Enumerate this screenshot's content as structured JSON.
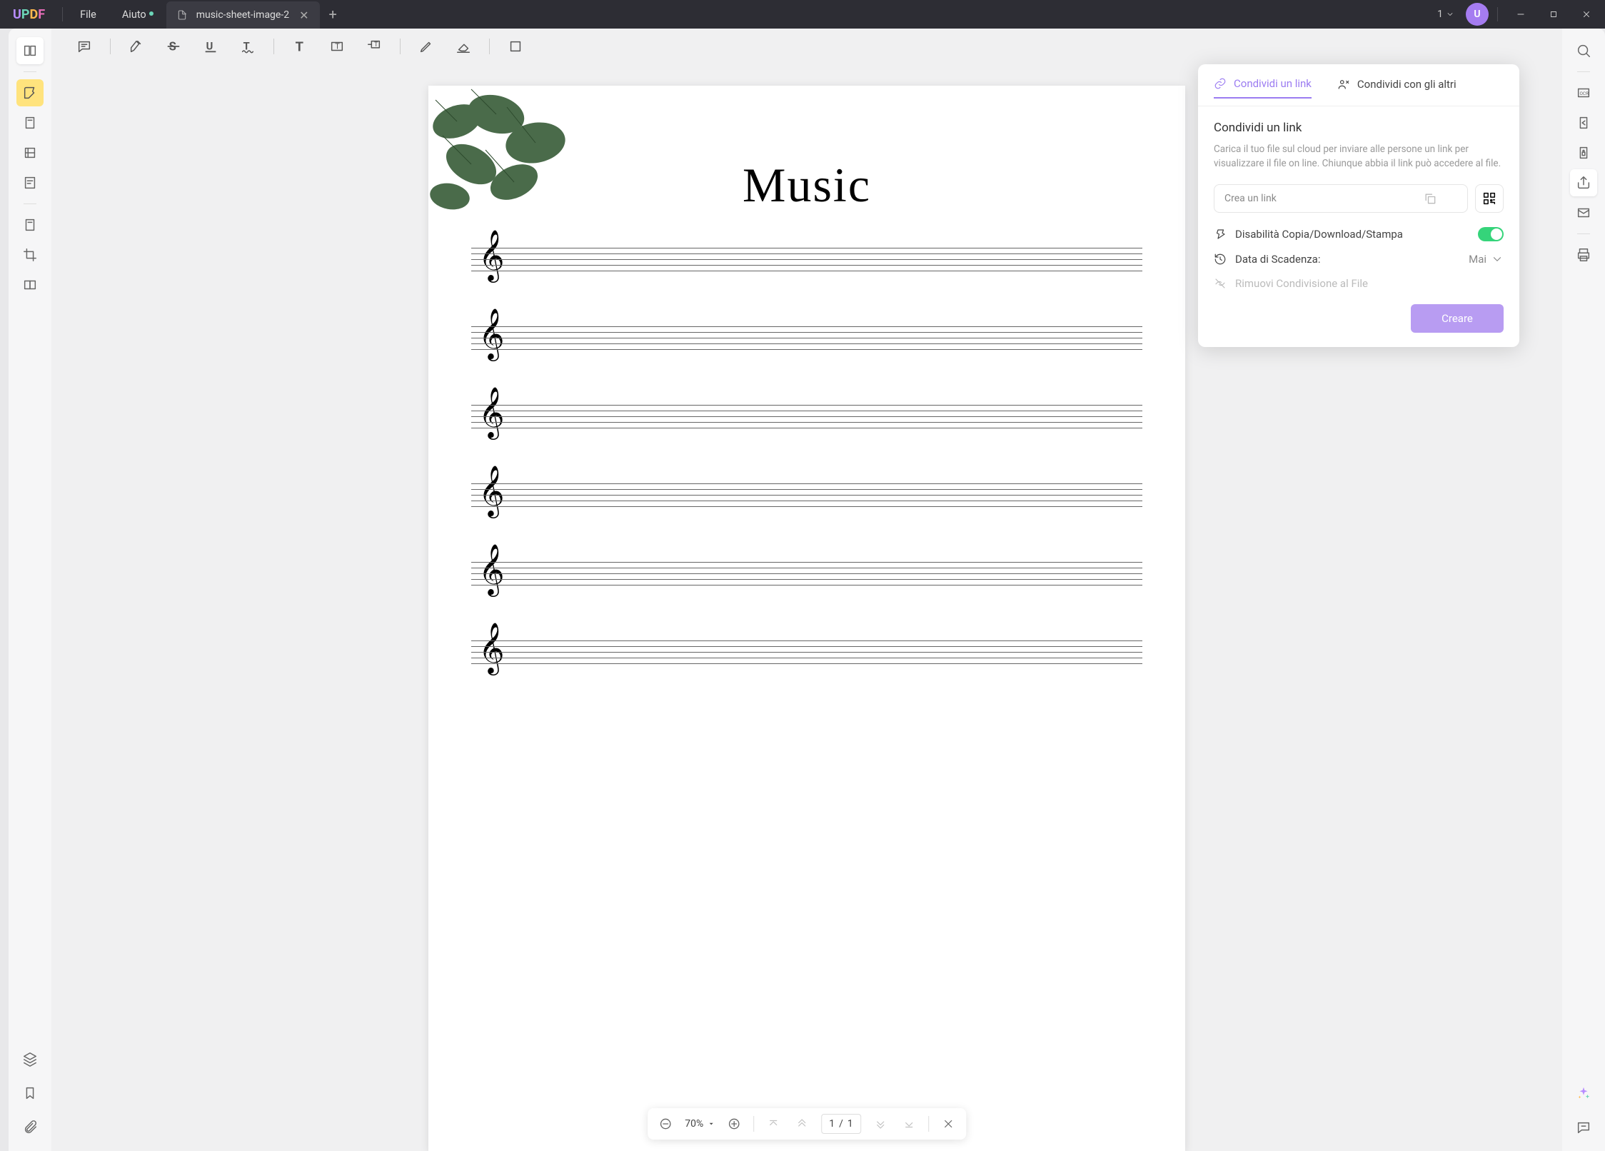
{
  "titlebar": {
    "menu_file": "File",
    "menu_help": "Aiuto",
    "tab_title": "music-sheet-image-2",
    "tab_count": "1",
    "avatar_letter": "U"
  },
  "toolbar": {
    "items": [
      "comment",
      "highlight",
      "strike",
      "underline",
      "squiggly",
      "text",
      "textbox",
      "text-callout",
      "pencil",
      "eraser",
      "shape"
    ]
  },
  "document": {
    "title": "Music",
    "staff_count": 6
  },
  "share": {
    "tab_link": "Condividi un link",
    "tab_others": "Condividi con gli altri",
    "heading": "Condividi un link",
    "description": "Carica il tuo file sul cloud per inviare alle persone un link per visualizzare il file on line. Chiunque abbia il link può accedere al file.",
    "link_placeholder": "Crea un link",
    "opt_disable": "Disabilità Copia/Download/Stampa",
    "opt_expiry_label": "Data di Scadenza:",
    "opt_expiry_value": "Mai",
    "opt_remove": "Rimuovi Condivisione al File",
    "create_btn": "Creare"
  },
  "zoom": {
    "percent": "70%",
    "page_current": "1",
    "page_sep": "/",
    "page_total": "1"
  }
}
